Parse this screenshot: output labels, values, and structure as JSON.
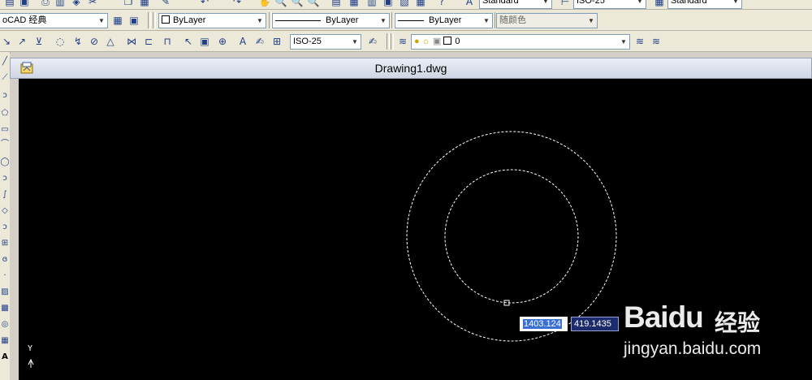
{
  "toolbar": {
    "text_style": "Standard",
    "dim_style": "ISO-25",
    "table_style": "Standard",
    "workspace": "oCAD 经典",
    "layer_color": "ByLayer",
    "linetype": "ByLayer",
    "lineweight": "ByLayer",
    "plot_style": "随颜色",
    "dim_style_current": "ISO-25",
    "layer_current": "0"
  },
  "drawing": {
    "title": "Drawing1.dwg",
    "coord_x": "1403.124",
    "coord_y": "419.1435",
    "ucs_label": "Y",
    "colors": {
      "background": "#000000",
      "entity": "#ffffff",
      "input_highlight": "#3a70d6"
    },
    "circles": [
      {
        "name": "outer-circle",
        "state": "selected-dashed"
      },
      {
        "name": "inner-circle",
        "state": "selected-dashed"
      }
    ]
  },
  "icons": {
    "row2": [
      "layer-manager-icon",
      "layer-state-icon"
    ],
    "row3": [
      "dim-linear-icon",
      "dim-aligned-icon",
      "dim-ordinate-icon",
      "dim-radius-icon",
      "dim-jogged-icon",
      "dim-diameter-icon",
      "dim-angular-icon",
      "dim-quick-icon",
      "dim-baseline-icon",
      "dim-continue-icon",
      "dim-leader-icon",
      "tolerance-icon",
      "center-mark-icon",
      "dim-edit-icon",
      "dim-text-edit-icon",
      "dim-update-icon",
      "dim-style-icon",
      "layer-properties-icon",
      "layer-on-icon",
      "layer-freeze-icon",
      "layer-lock-icon",
      "layer-color-icon",
      "layer-previous-icon",
      "layer-isolate-icon"
    ]
  },
  "watermark": {
    "brand": "Baidu",
    "brand_cn": "经验",
    "sub": "jingyan.baidu.com"
  }
}
